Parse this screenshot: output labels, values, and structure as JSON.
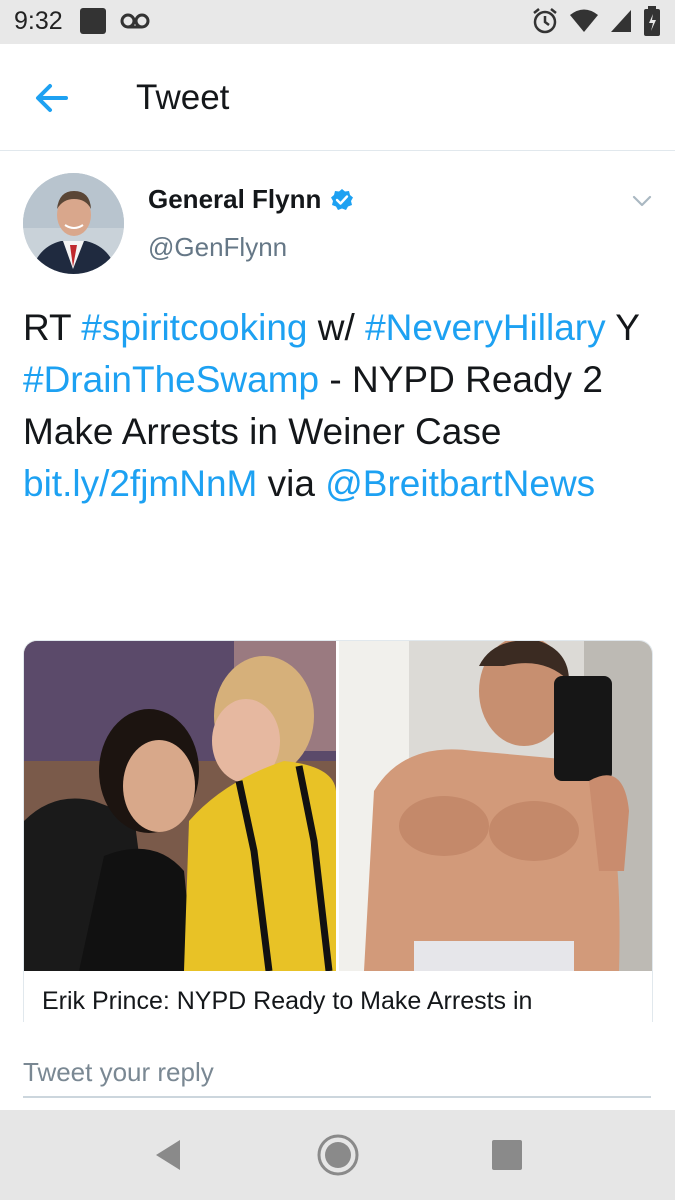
{
  "status_bar": {
    "time": "9:32"
  },
  "header": {
    "title": "Tweet"
  },
  "tweet": {
    "author_name": "General Flynn",
    "handle": "@GenFlynn",
    "segments": [
      {
        "t": "RT ",
        "link": false
      },
      {
        "t": "#spiritcooking",
        "link": true
      },
      {
        "t": " w/ ",
        "link": false
      },
      {
        "t": "#NeveryHillary",
        "link": true
      },
      {
        "t": " Y ",
        "link": false
      },
      {
        "t": "#DrainTheSwamp",
        "link": true
      },
      {
        "t": " - NYPD Ready 2 Make Arrests in Weiner Case ",
        "link": false
      },
      {
        "t": "bit.ly/2fjmNnM",
        "link": true
      },
      {
        "t": " via ",
        "link": false
      },
      {
        "t": "@BreitbartNews",
        "link": true
      }
    ],
    "card_title": "Erik Prince: NYPD Ready to Make Arrests in"
  },
  "reply": {
    "placeholder": "Tweet your reply"
  },
  "colors": {
    "accent": "#1da1f2",
    "text": "#14171a",
    "secondary": "#657786"
  }
}
